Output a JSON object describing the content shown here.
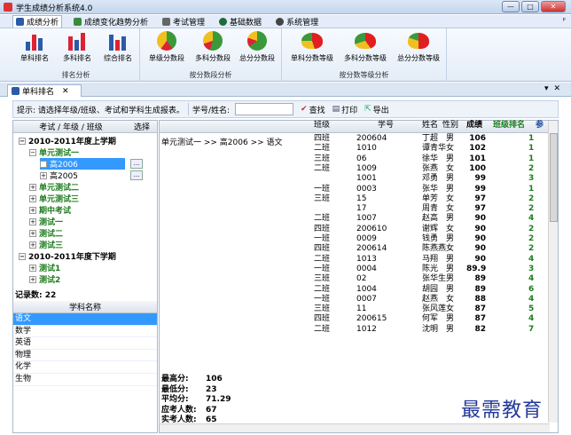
{
  "window": {
    "title": "学生成绩分析系统4.0",
    "min": "—",
    "max": "□",
    "close": "✕"
  },
  "menu": [
    "成绩分析",
    "成绩变化趋势分析",
    "考试管理",
    "基础数据",
    "系统管理"
  ],
  "ribbon": {
    "groups": [
      {
        "label": "排名分析",
        "buttons": [
          "单科排名",
          "多科排名",
          "综合排名"
        ]
      },
      {
        "label": "按分数段分析",
        "buttons": [
          "单级分数段",
          "多科分数段",
          "总分分数段"
        ]
      },
      {
        "label": "按分数等级分析",
        "buttons": [
          "单科分数等级",
          "多科分数等级",
          "总分分数等级"
        ]
      }
    ]
  },
  "doctab": {
    "label": "单科排名",
    "close": "✕"
  },
  "toolbar": {
    "hint": "提示: 请选择年级/班级、考试和学科生成报表。",
    "search_label": "学号/姓名:",
    "search_value": "",
    "find": "查找",
    "print": "打印",
    "export": "导出"
  },
  "left": {
    "headers": [
      "考试 / 年级 / 班级",
      "选择"
    ],
    "tree": [
      {
        "t": "2010-2011年度上学期",
        "lv": 0,
        "bold": true,
        "pm": "⊟"
      },
      {
        "t": "单元测试一",
        "lv": 1,
        "green": true,
        "pm": "⊟"
      },
      {
        "t": "高2006",
        "lv": 2,
        "sel": true,
        "pm": "⊞",
        "btn": "..."
      },
      {
        "t": "高2005",
        "lv": 2,
        "pm": "⊞",
        "btn": "..."
      },
      {
        "t": "单元测试二",
        "lv": 1,
        "green": true,
        "pm": "⊞"
      },
      {
        "t": "单元测试三",
        "lv": 1,
        "green": true,
        "pm": "⊞"
      },
      {
        "t": "期中考试",
        "lv": 1,
        "green": true,
        "pm": "⊞"
      },
      {
        "t": "测试一",
        "lv": 1,
        "green": true,
        "pm": "⊞"
      },
      {
        "t": "测试二",
        "lv": 1,
        "green": true,
        "pm": "⊞"
      },
      {
        "t": "测试三",
        "lv": 1,
        "green": true,
        "pm": "⊞"
      },
      {
        "t": "2010-2011年度下学期",
        "lv": 0,
        "bold": true,
        "pm": "⊟"
      },
      {
        "t": "测试1",
        "lv": 1,
        "green": true,
        "pm": "⊞"
      },
      {
        "t": "测试2",
        "lv": 1,
        "green": true,
        "pm": "⊞"
      }
    ],
    "record_count": "记录数: 22",
    "subject_header": "学科名称",
    "subjects": [
      "语文",
      "数学",
      "英语",
      "物理",
      "化学",
      "生物"
    ]
  },
  "table": {
    "path": "单元测试一 >> 高2006 >> 语文",
    "headers": [
      "班级",
      "学号",
      "姓名",
      "性别",
      "成绩",
      "班级排名",
      "参"
    ],
    "rows": [
      [
        "四班",
        "200604",
        "丁超",
        "男",
        "106",
        "1"
      ],
      [
        "二班",
        "1010",
        "谭青华",
        "女",
        "102",
        "1"
      ],
      [
        "三班",
        "06",
        "徐华",
        "男",
        "101",
        "1"
      ],
      [
        "二班",
        "1009",
        "张燕",
        "女",
        "100",
        "2"
      ],
      [
        "",
        "1001",
        "邓勇",
        "男",
        "99",
        "3"
      ],
      [
        "一班",
        "0003",
        "张华",
        "男",
        "99",
        "1"
      ],
      [
        "三班",
        "15",
        "单芳",
        "女",
        "97",
        "2"
      ],
      [
        "",
        "17",
        "周青",
        "女",
        "97",
        "2"
      ],
      [
        "二班",
        "1007",
        "赵高",
        "男",
        "90",
        "4"
      ],
      [
        "四班",
        "200610",
        "谢辉",
        "女",
        "90",
        "2"
      ],
      [
        "一班",
        "0009",
        "钱勇",
        "男",
        "90",
        "2"
      ],
      [
        "四班",
        "200614",
        "陈燕燕",
        "女",
        "90",
        "2"
      ],
      [
        "二班",
        "1013",
        "马翔",
        "男",
        "90",
        "4"
      ],
      [
        "一班",
        "0004",
        "陈光",
        "男",
        "89.9",
        "3"
      ],
      [
        "三班",
        "02",
        "张华生",
        "男",
        "89",
        "4"
      ],
      [
        "二班",
        "1004",
        "胡园",
        "男",
        "89",
        "6"
      ],
      [
        "一班",
        "0007",
        "赵燕",
        "女",
        "88",
        "4"
      ],
      [
        "三班",
        "11",
        "张风莲",
        "女",
        "87",
        "5"
      ],
      [
        "四班",
        "200615",
        "何军",
        "男",
        "87",
        "4"
      ],
      [
        "二班",
        "1012",
        "沈明",
        "男",
        "82",
        "7"
      ]
    ],
    "stats": [
      {
        "k": "最高分:",
        "v": "106"
      },
      {
        "k": "最低分:",
        "v": "23"
      },
      {
        "k": "平均分:",
        "v": "71.29"
      },
      {
        "k": "应考人数:",
        "v": "67"
      },
      {
        "k": "实考人数:",
        "v": "65"
      }
    ]
  },
  "watermark": "最需教育"
}
